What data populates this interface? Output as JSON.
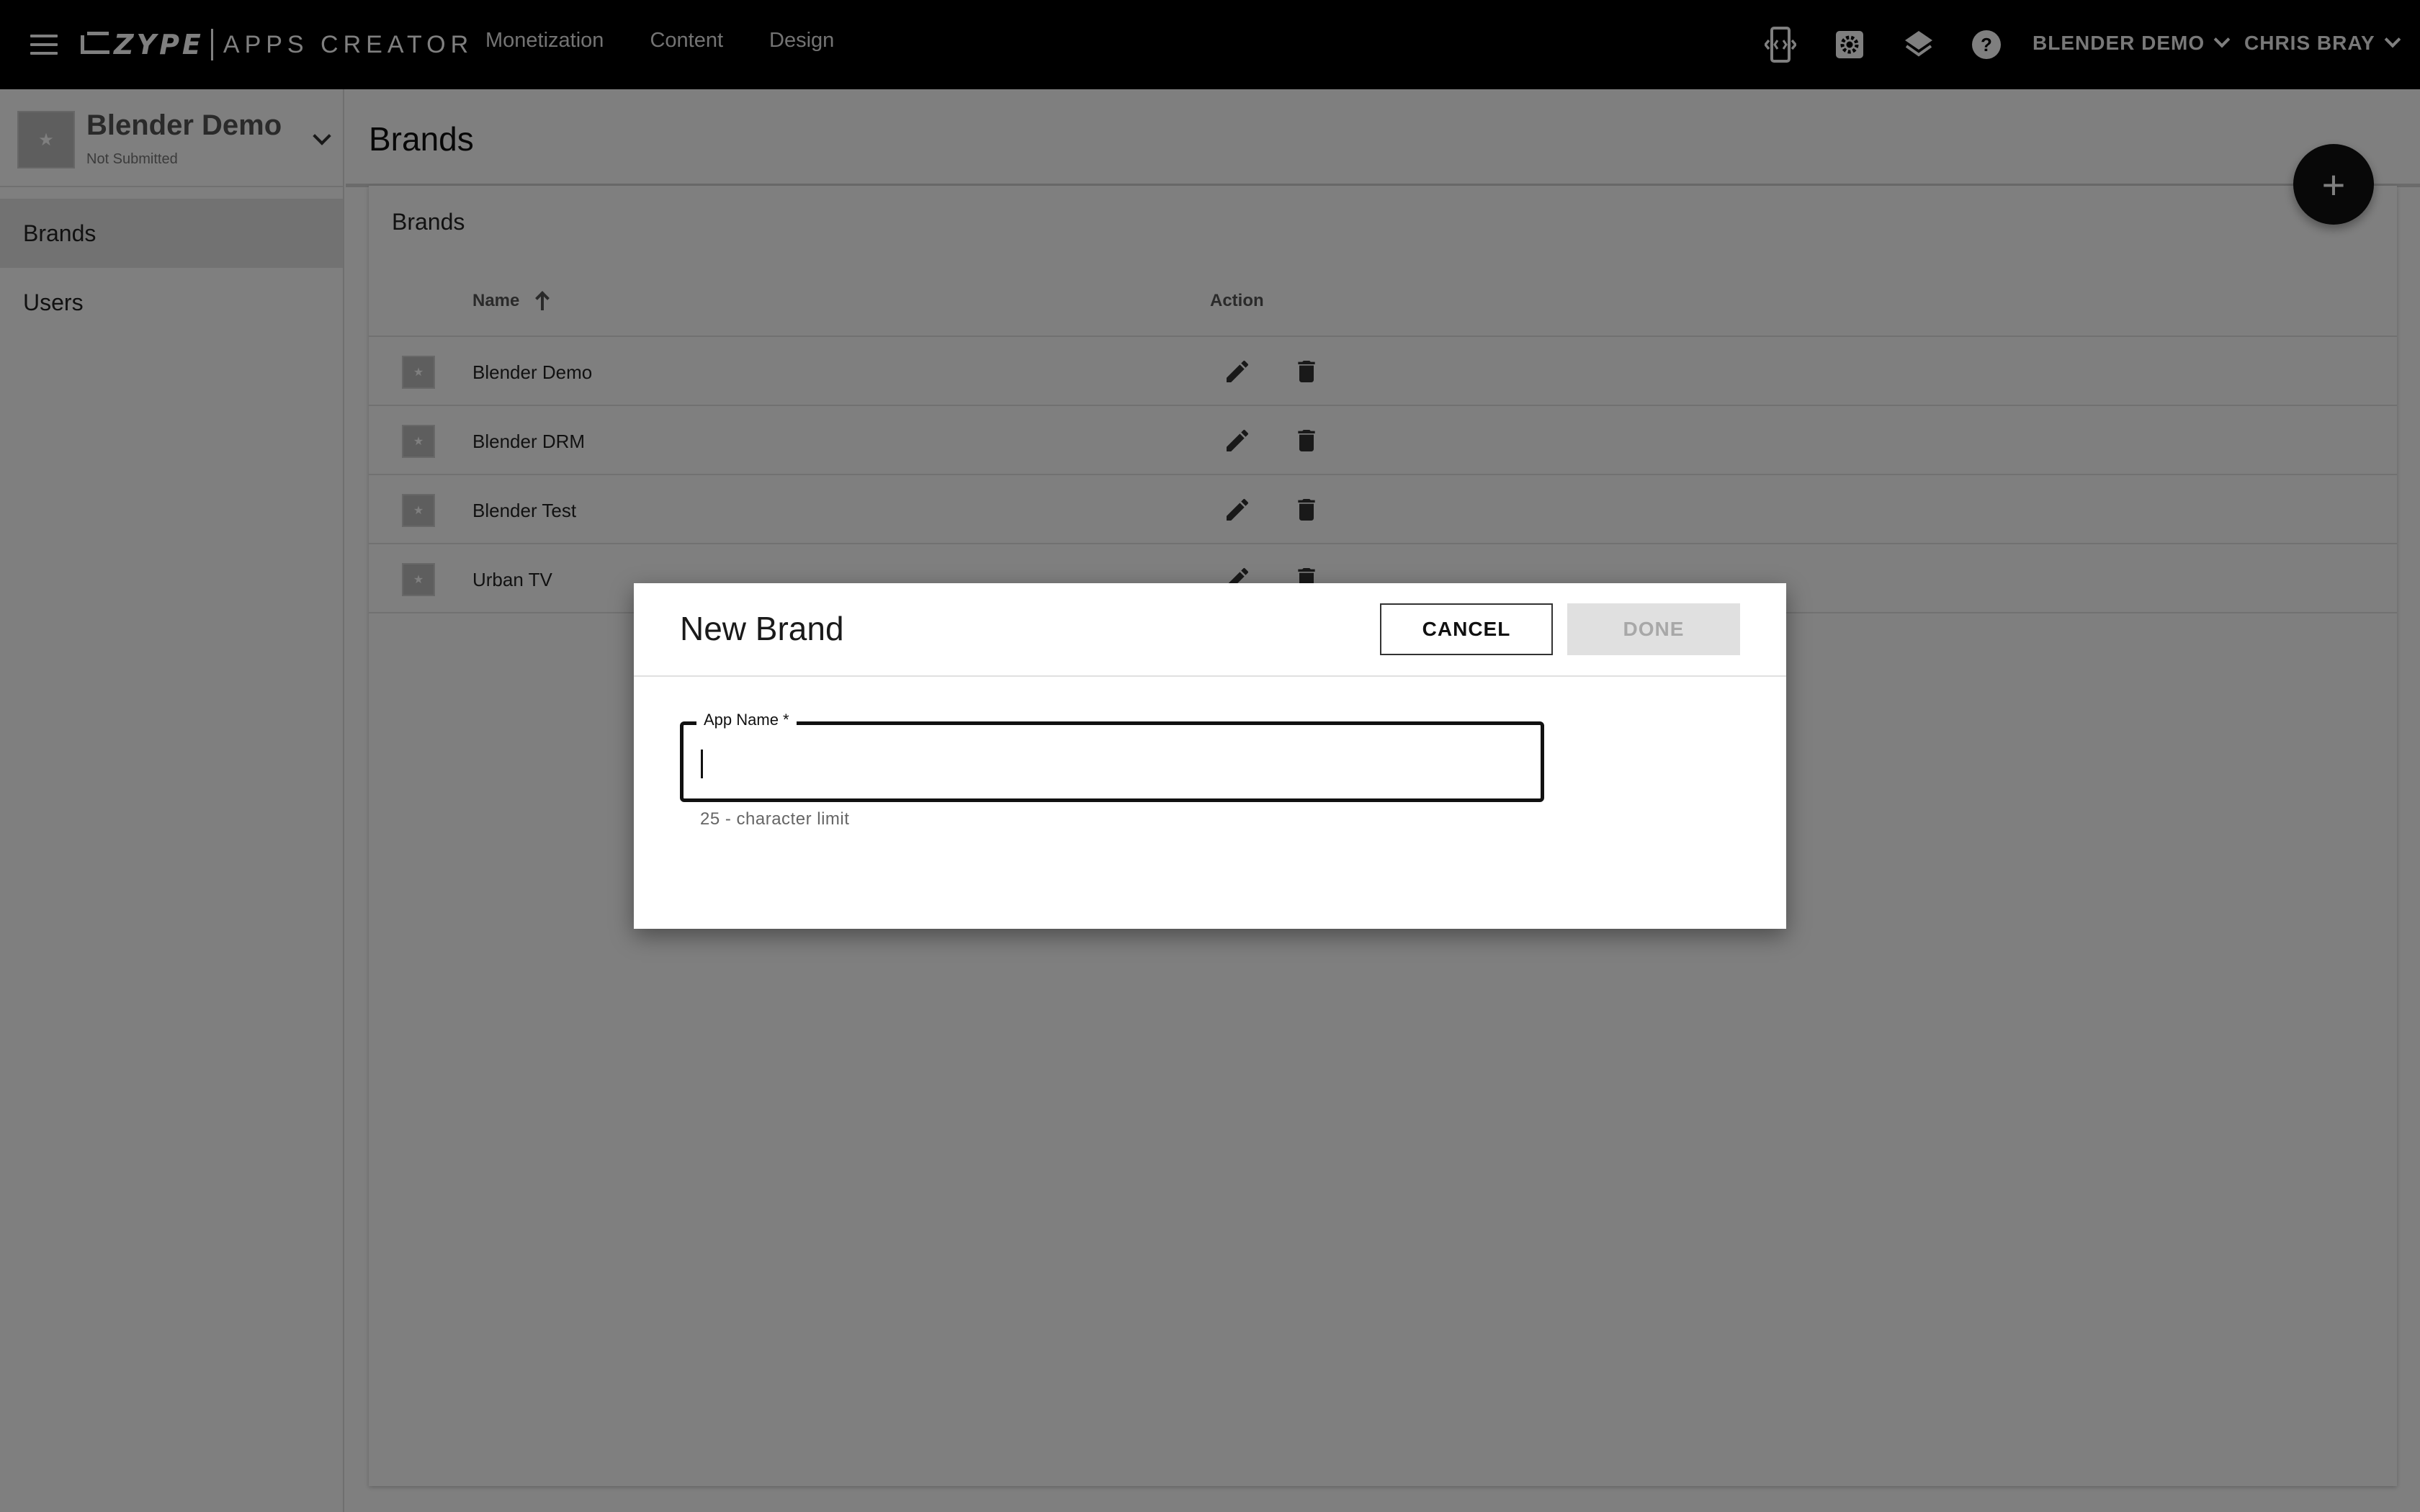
{
  "topbar": {
    "logo_main": "ZYPE",
    "logo_sub": "APPS CREATOR",
    "nav": [
      "Monetization",
      "Content",
      "Design"
    ],
    "icons": [
      "preview-device-icon",
      "settings-gear-icon",
      "layers-icon",
      "help-icon"
    ],
    "account_dropdown": "BLENDER DEMO",
    "user_dropdown": "CHRIS BRAY"
  },
  "sidebar": {
    "app_name": "Blender Demo",
    "app_status": "Not Submitted",
    "items": [
      {
        "label": "Brands",
        "active": true
      },
      {
        "label": "Users",
        "active": false
      }
    ]
  },
  "main": {
    "page_title": "Brands",
    "fab_label": "+",
    "card_title": "Brands",
    "table": {
      "columns": [
        "Name",
        "Action"
      ],
      "sort": {
        "column": "Name",
        "direction": "ascending"
      },
      "rows": [
        {
          "name": "Blender Demo"
        },
        {
          "name": "Blender DRM"
        },
        {
          "name": "Blender Test"
        },
        {
          "name": "Urban TV"
        }
      ]
    }
  },
  "dialog": {
    "title": "New Brand",
    "cancel_label": "CANCEL",
    "done_label": "DONE",
    "done_enabled": false,
    "field_label": "App Name *",
    "field_value": "",
    "helper_text": "25 - character limit"
  },
  "colors": {
    "topbar_bg": "#000000",
    "overlay": "rgba(0,0,0,0.5)",
    "active_sidebar": "#e4e4e4"
  }
}
